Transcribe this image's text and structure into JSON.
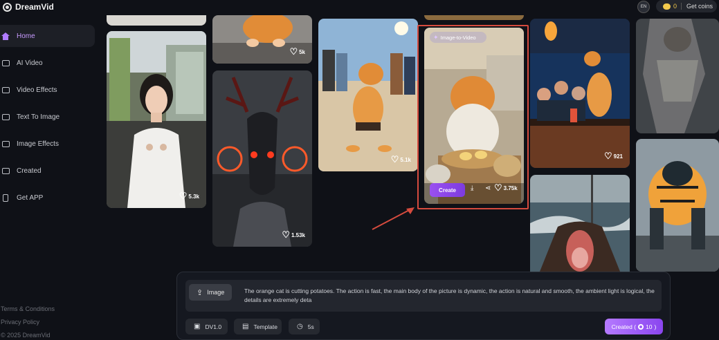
{
  "app": {
    "name": "DreamVid"
  },
  "header": {
    "language_icon": "language-icon",
    "coins": "0",
    "get_coins_label": "Get coins",
    "coin_color": "#f2c94c"
  },
  "sidebar": {
    "items": [
      {
        "label": "Home",
        "icon": "home-icon",
        "active": true
      },
      {
        "label": "AI Video",
        "icon": "ai-video-icon"
      },
      {
        "label": "Video Effects",
        "icon": "video-effects-icon"
      },
      {
        "label": "Text To Image",
        "icon": "text-to-image-icon"
      },
      {
        "label": "Image Effects",
        "icon": "image-effects-icon"
      },
      {
        "label": "Created",
        "icon": "created-icon"
      },
      {
        "label": "Get APP",
        "icon": "phone-icon"
      }
    ],
    "footer": {
      "terms": "Terms & Conditions",
      "privacy": "Privacy Policy",
      "copyright": "© 2025 DreamVid"
    }
  },
  "feed": {
    "cards": [
      {
        "likes": "5.3k"
      },
      {
        "likes": "5k"
      },
      {
        "likes": "1.53k"
      },
      {
        "likes": "5.1k"
      },
      {
        "likes": "921"
      }
    ],
    "highlighted": {
      "badge": "Image-to-Video",
      "create_label": "Create",
      "likes": "3.75k"
    }
  },
  "composer": {
    "image_label": "Image",
    "prompt": "The orange cat is cutting potatoes. The action is fast, the main body of the picture is dynamic, the action is natural and smooth, the ambient light is logical, the details are extremely deta",
    "model_label": "DV1.0",
    "template_label": "Template",
    "duration_label": "5s",
    "created_label_pre": "Created (",
    "created_cost": "10",
    "created_label_post": ")"
  },
  "colors": {
    "accent": "#9a50f0",
    "highlight_border": "#d64b3e",
    "background": "#0f1117"
  }
}
